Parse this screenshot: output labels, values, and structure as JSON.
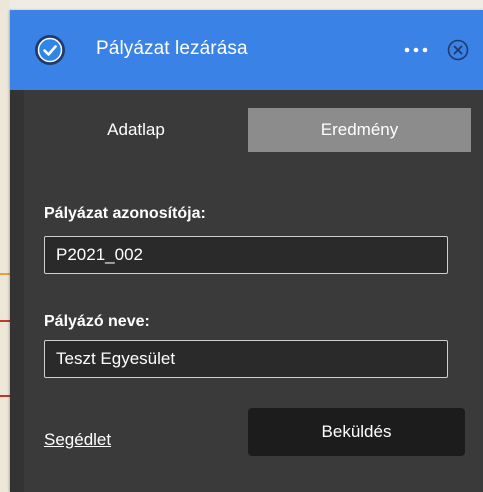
{
  "header": {
    "title": "Pályázat lezárása",
    "accent_color": "#3b82e6",
    "icons": [
      "check-circle-icon",
      "more-icon",
      "close-icon"
    ]
  },
  "tabs": [
    {
      "label": "Adatlap",
      "active": true
    },
    {
      "label": "Eredmény",
      "active": false
    }
  ],
  "form": {
    "id_label": "Pályázat azonosítója:",
    "id_value": "P2021_002",
    "applicant_label": "Pályázó neve:",
    "applicant_value": "Teszt Egyesület"
  },
  "footer": {
    "help_link": "Segédlet",
    "submit_label": "Beküldés"
  }
}
